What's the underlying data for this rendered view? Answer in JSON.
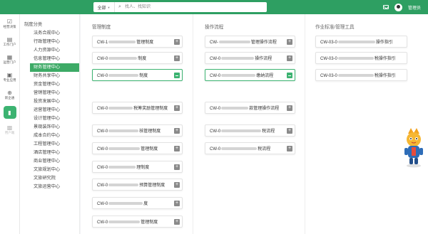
{
  "header": {
    "search_scope": "全部",
    "search_placeholder": "找人、找知识",
    "user_name": "管理员"
  },
  "rail": {
    "items": [
      {
        "label": "经营决策",
        "icon": "chart-icon"
      },
      {
        "label": "工作门户",
        "icon": "portal-icon"
      },
      {
        "label": "运营门户",
        "icon": "ops-icon"
      },
      {
        "label": "专业应用",
        "icon": "apps-icon"
      },
      {
        "label": "新企通",
        "icon": "plus-circle-icon"
      },
      {
        "label": "",
        "icon": "document-icon"
      },
      {
        "label": "用户端",
        "icon": "user-icon"
      }
    ]
  },
  "category_menu": {
    "title": "制度分类",
    "items": [
      "法务合规中心",
      "行政管理中心",
      "人力资源中心",
      "信息管理中心",
      "财务管理中心",
      "财务共享中心",
      "资金管理中心",
      "营销管理中心",
      "投资发展中心",
      "运营管理中心",
      "设计管理中心",
      "景观装饰中心",
      "成本合约中心",
      "工程管理中心",
      "酒店管理中心",
      "商业管理中心",
      "文旅规划中心",
      "文旅研究院",
      "文旅运营中心"
    ],
    "active": "财务管理中心"
  },
  "columns": [
    {
      "title": "管理制度",
      "cards": [
        {
          "prefix": "CW-1",
          "suffix": "管理制度"
        },
        {
          "prefix": "CW-0",
          "suffix": "制度"
        },
        {
          "prefix": "CW-0",
          "suffix": "制度"
        },
        {
          "prefix": "CW-0",
          "suffix": "税筹奖励管理制度"
        },
        {
          "prefix": "CW-0",
          "suffix": "核管理制度"
        },
        {
          "prefix": "CW-0",
          "suffix": "管理制度"
        },
        {
          "prefix": "CW-0",
          "suffix": "理制度"
        },
        {
          "prefix": "CW-0",
          "suffix": "预算管理制度"
        },
        {
          "prefix": "CW-0",
          "suffix": "度"
        },
        {
          "prefix": "CW-0",
          "suffix": "管理制度"
        }
      ]
    },
    {
      "title": "操作流程",
      "cards": [
        {
          "prefix": "CW-",
          "suffix": "管理操作流程"
        },
        {
          "prefix": "CW-0",
          "suffix": "操作流程"
        },
        {
          "prefix": "CW-0",
          "suffix": "缴纳流程"
        },
        {
          "prefix": "CW-0",
          "suffix": "款管理操作流程"
        },
        {
          "prefix": "CW-0",
          "suffix": "税流程"
        },
        {
          "prefix": "CW-0",
          "suffix": "税流程"
        }
      ]
    },
    {
      "title": "作业标准/管理工具",
      "cards": [
        {
          "prefix": "CW-03-0",
          "suffix": "操作指引"
        },
        {
          "prefix": "CW-03-0",
          "suffix": "税操作指引"
        },
        {
          "prefix": "CW-03-0",
          "suffix": "税操作指引"
        }
      ]
    }
  ]
}
